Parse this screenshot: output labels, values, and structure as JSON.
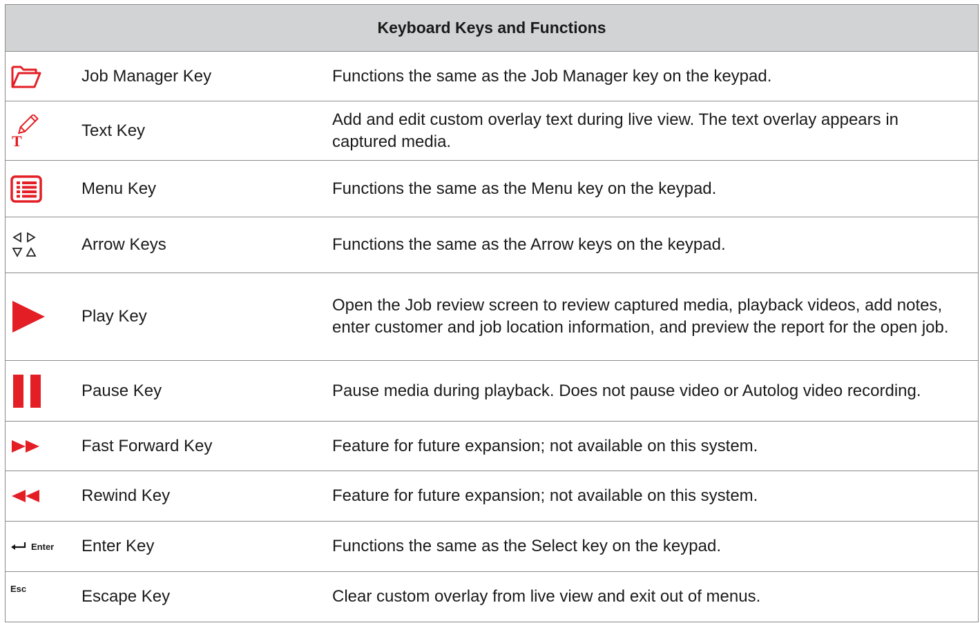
{
  "table": {
    "title": "Keyboard Keys and Functions",
    "rows": [
      {
        "icon": "folder-icon",
        "name": "Job Manager Key",
        "desc": "Functions the same as the Job Manager key on the keypad."
      },
      {
        "icon": "text-pencil-icon",
        "name": "Text Key",
        "desc": "Add and edit custom overlay text during live view. The text overlay appears in captured media."
      },
      {
        "icon": "menu-list-icon",
        "name": "Menu Key",
        "desc": "Functions the same as the Menu key on the keypad."
      },
      {
        "icon": "arrow-keys-icon",
        "name": "Arrow Keys",
        "desc": "Functions the same as the Arrow keys on the keypad."
      },
      {
        "icon": "play-icon",
        "name": "Play Key",
        "desc": "Open the Job review screen to review captured media, playback videos, add notes, enter customer and job location information, and preview the report for the open job."
      },
      {
        "icon": "pause-icon",
        "name": "Pause Key",
        "desc": "Pause media during playback. Does not pause video or Autolog video recording."
      },
      {
        "icon": "fast-forward-icon",
        "name": "Fast Forward Key",
        "desc": "Feature for future expansion; not available on this system."
      },
      {
        "icon": "rewind-icon",
        "name": "Rewind Key",
        "desc": "Feature for future expansion; not available on this system."
      },
      {
        "icon": "enter-icon",
        "name": "Enter Key",
        "desc": "Functions the same as the Select key on the keypad.",
        "icon_label": "Enter"
      },
      {
        "icon": "esc-icon",
        "name": "Escape Key",
        "desc": "Clear custom overlay from live view and exit out of menus.",
        "icon_label": "Esc"
      }
    ]
  },
  "colors": {
    "accent_red": "#e31e24",
    "header_bg": "#d1d3d4",
    "border": "#8a8a8a"
  }
}
